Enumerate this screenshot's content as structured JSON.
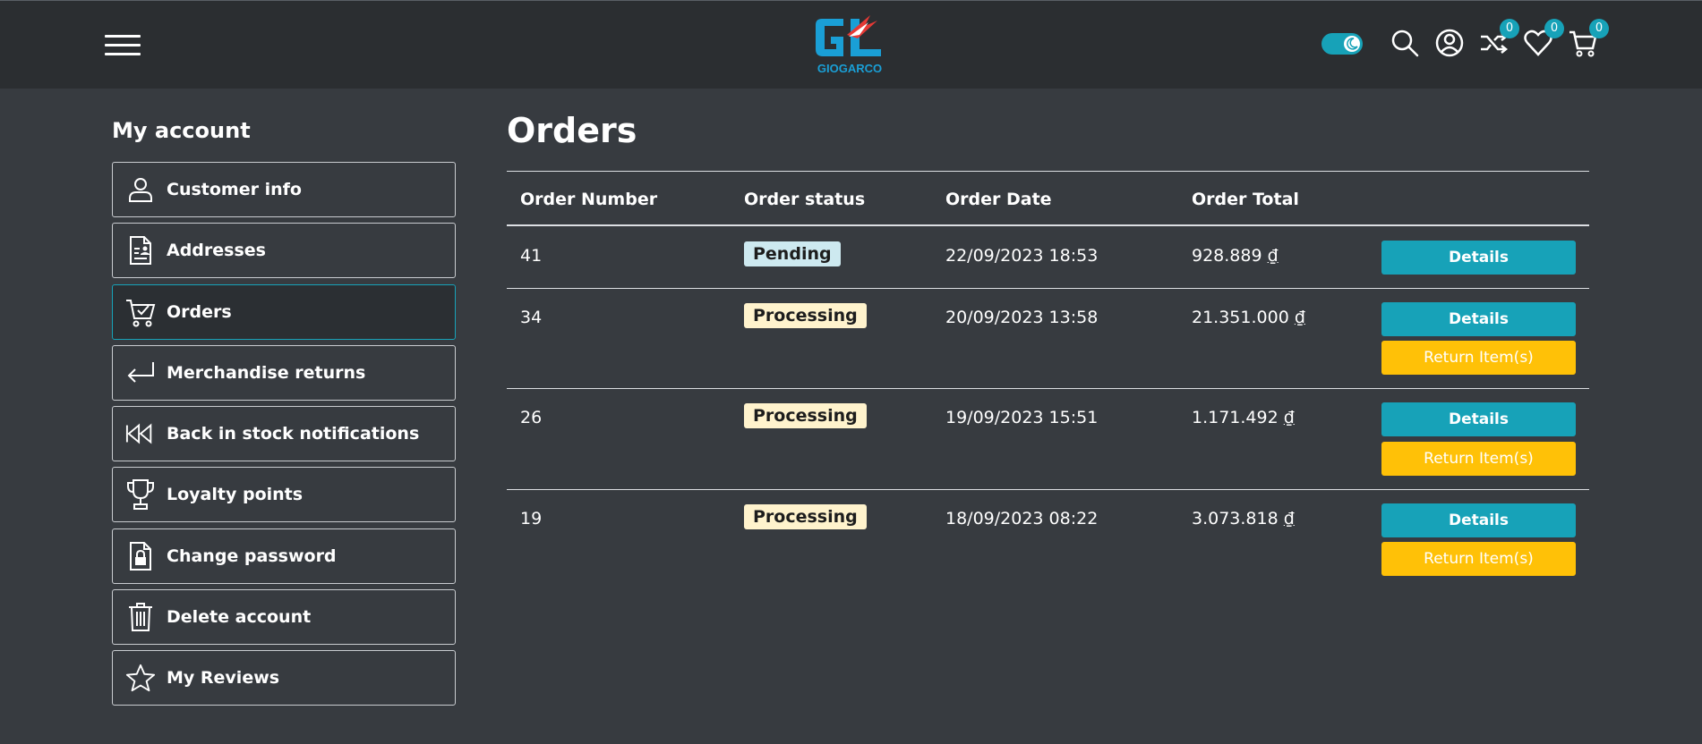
{
  "header": {
    "logo_text": "GIOGARCO",
    "compare_count": "0",
    "wishlist_count": "0",
    "cart_count": "0"
  },
  "sidebar": {
    "title": "My account",
    "items": [
      {
        "label": "Customer info",
        "icon": "user-icon"
      },
      {
        "label": "Addresses",
        "icon": "address-document-icon"
      },
      {
        "label": "Orders",
        "icon": "cart-check-icon",
        "active": true
      },
      {
        "label": "Merchandise returns",
        "icon": "return-arrow-icon"
      },
      {
        "label": "Back in stock notifications",
        "icon": "rewind-icon"
      },
      {
        "label": "Loyalty points",
        "icon": "trophy-icon"
      },
      {
        "label": "Change password",
        "icon": "lock-file-icon"
      },
      {
        "label": "Delete account",
        "icon": "trash-icon"
      },
      {
        "label": "My Reviews",
        "icon": "star-icon"
      }
    ]
  },
  "main": {
    "title": "Orders",
    "columns": [
      "Order Number",
      "Order status",
      "Order Date",
      "Order Total"
    ],
    "details_label": "Details",
    "return_label": "Return Item(s)",
    "orders": [
      {
        "number": "41",
        "status": "Pending",
        "date": "22/09/2023 18:53",
        "total": "928.889",
        "currency": "₫"
      },
      {
        "number": "34",
        "status": "Processing",
        "date": "20/09/2023 13:58",
        "total": "21.351.000",
        "currency": "₫"
      },
      {
        "number": "26",
        "status": "Processing",
        "date": "19/09/2023 15:51",
        "total": "1.171.492",
        "currency": "₫"
      },
      {
        "number": "19",
        "status": "Processing",
        "date": "18/09/2023 08:22",
        "total": "3.073.818",
        "currency": "₫"
      }
    ]
  },
  "colors": {
    "accent": "#17a2b8",
    "warning": "#ffc107",
    "background": "#373b40",
    "header": "#2b2e31"
  }
}
